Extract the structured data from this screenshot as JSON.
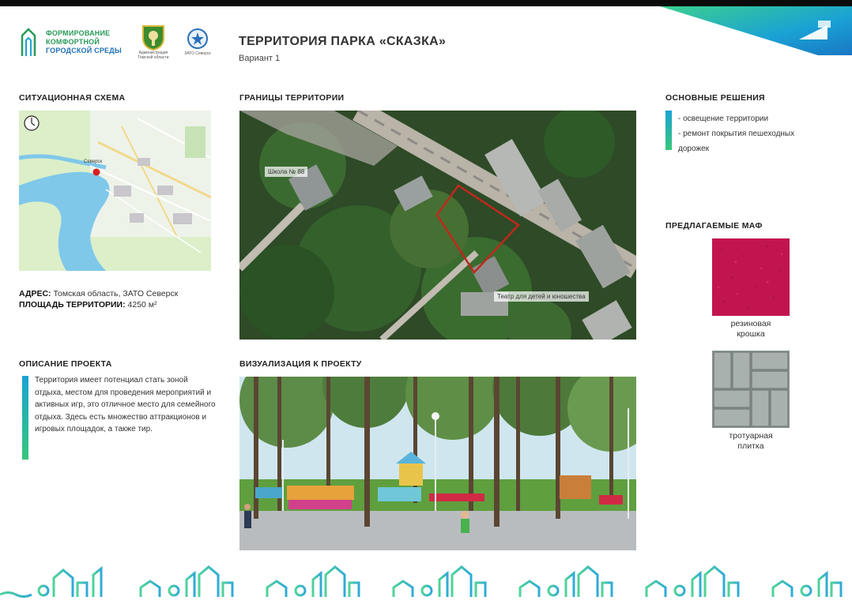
{
  "logos": {
    "program_line1": "ФОРМИРОВАНИЕ",
    "program_line2": "КОМФОРТНОЙ",
    "program_line3": "ГОРОДСКОЙ СРЕДЫ",
    "region_caption": "Администрация Томской области",
    "zato_caption": "ЗАТО Северск"
  },
  "header": {
    "title": "ТЕРРИТОРИЯ ПАРКА «СКАЗКА»",
    "subtitle": "Вариант 1"
  },
  "situation": {
    "heading": "СИТУАЦИОННАЯ СХЕМА",
    "map_place_label": "Северск"
  },
  "address": {
    "address_label": "АДРЕС:",
    "address_value": "Томская область, ЗАТО Северск",
    "area_label": "ПЛОЩАДЬ ТЕРРИТОРИИ:",
    "area_value": "4250 м²"
  },
  "borders": {
    "heading": "ГРАНИЦЫ ТЕРРИТОРИИ",
    "label_school": "Школа № 88",
    "label_theatre": "Театр для детей и юношества"
  },
  "description": {
    "heading": "ОПИСАНИЕ ПРОЕКТА",
    "text": "Территория имеет потенциал стать зоной отдыха, местом для проведения мероприятий и активных игр, это отличное место для семейного отдыха. Здесь есть множество аттракционов и игровых площадок, а также тир."
  },
  "visualization": {
    "heading": "ВИЗУАЛИЗАЦИЯ К ПРОЕКТУ"
  },
  "decisions": {
    "heading": "ОСНОВНЫЕ РЕШЕНИЯ",
    "items": [
      "- освещение территории",
      "- ремонт покрытия пешеходных",
      "дорожек"
    ]
  },
  "maf": {
    "heading": "ПРЕДЛАГАЕМЫЕ МАФ",
    "items": [
      {
        "label_line1": "резиновая",
        "label_line2": "крошка",
        "color": "#c2154f"
      },
      {
        "label_line1": "тротуарная",
        "label_line2": "плитка",
        "color": "#9aa3a1"
      }
    ]
  },
  "colors": {
    "accent_green": "#38c77a",
    "accent_blue": "#1aa2d4",
    "boundary_red": "#c0281c"
  }
}
